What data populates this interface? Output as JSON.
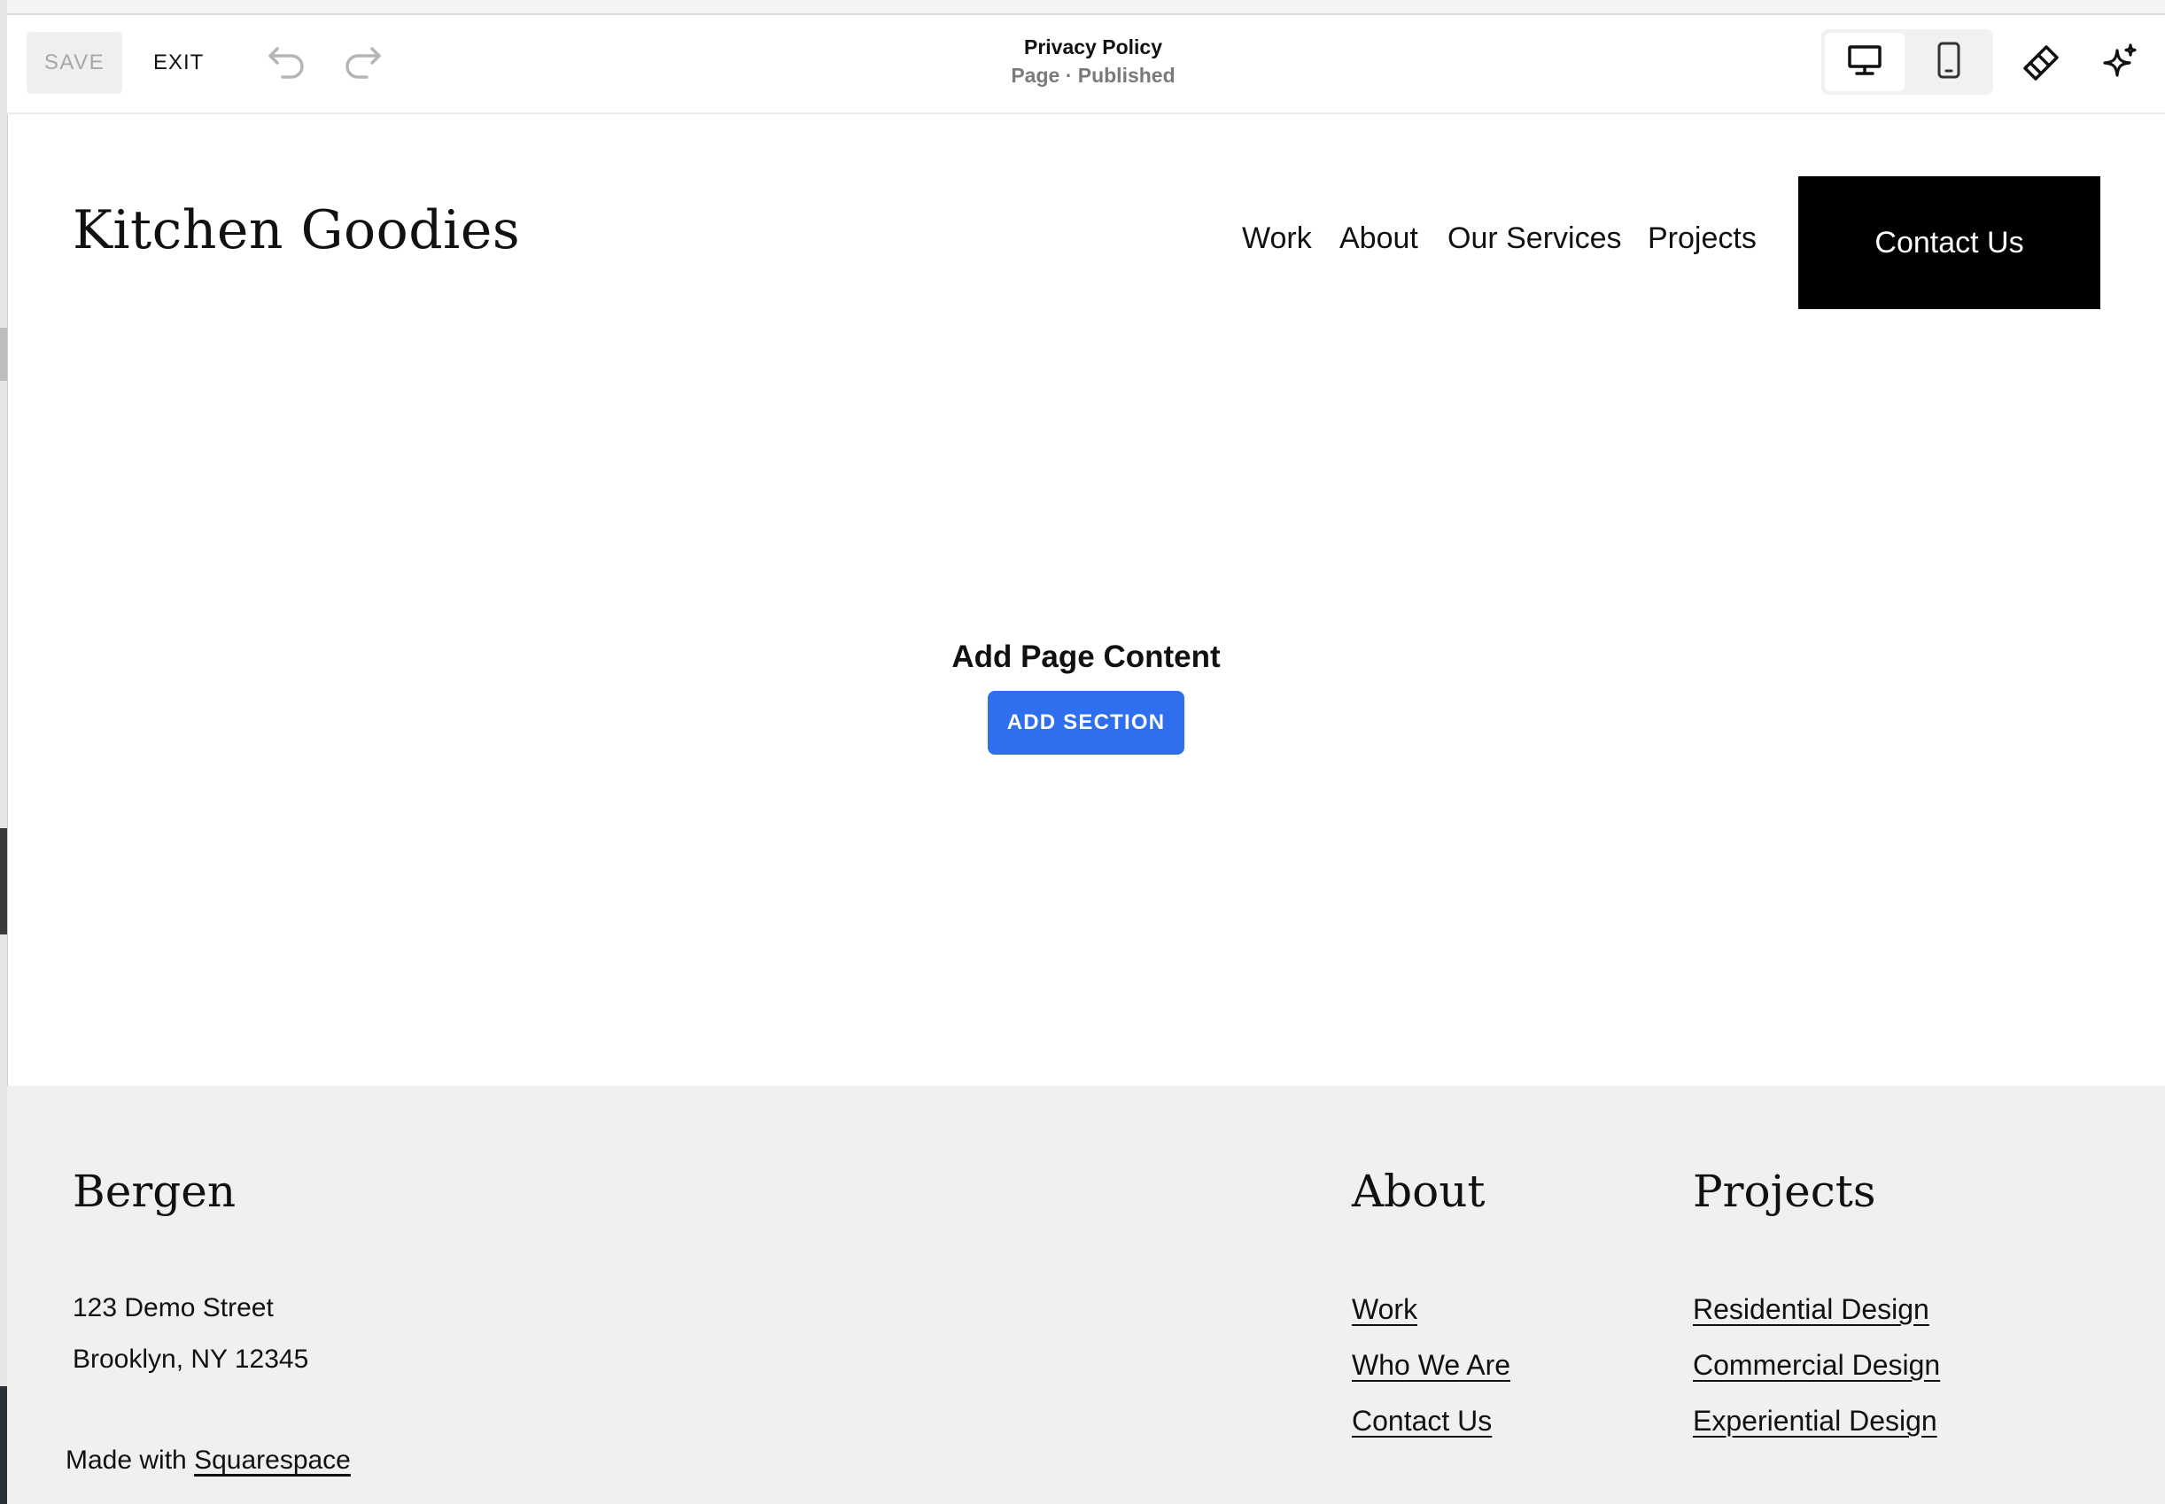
{
  "toolbar": {
    "save_label": "SAVE",
    "exit_label": "EXIT",
    "page_title": "Privacy Policy",
    "page_status": "Page · Published",
    "icons": [
      "undo-icon",
      "redo-icon",
      "desktop-icon",
      "mobile-icon",
      "brush-icon",
      "sparkle-icon"
    ]
  },
  "site": {
    "logo": "Kitchen Goodies",
    "nav": [
      "Work",
      "About",
      "Our Services",
      "Projects"
    ],
    "cta": "Contact Us"
  },
  "content": {
    "empty_title": "Add Page Content",
    "add_section_label": "ADD SECTION",
    "accent_color": "#2f6fee"
  },
  "footer": {
    "brand": "Bergen",
    "address_line1": "123 Demo Street",
    "address_line2": "Brooklyn, NY 12345",
    "made_with_prefix": "Made with",
    "made_with_link": "Squarespace",
    "about_heading": "About",
    "about_links": [
      "Work",
      "Who We Are",
      "Contact Us"
    ],
    "projects_heading": "Projects",
    "projects_links": [
      "Residential Design",
      "Commercial Design",
      "Experiential Design"
    ]
  }
}
